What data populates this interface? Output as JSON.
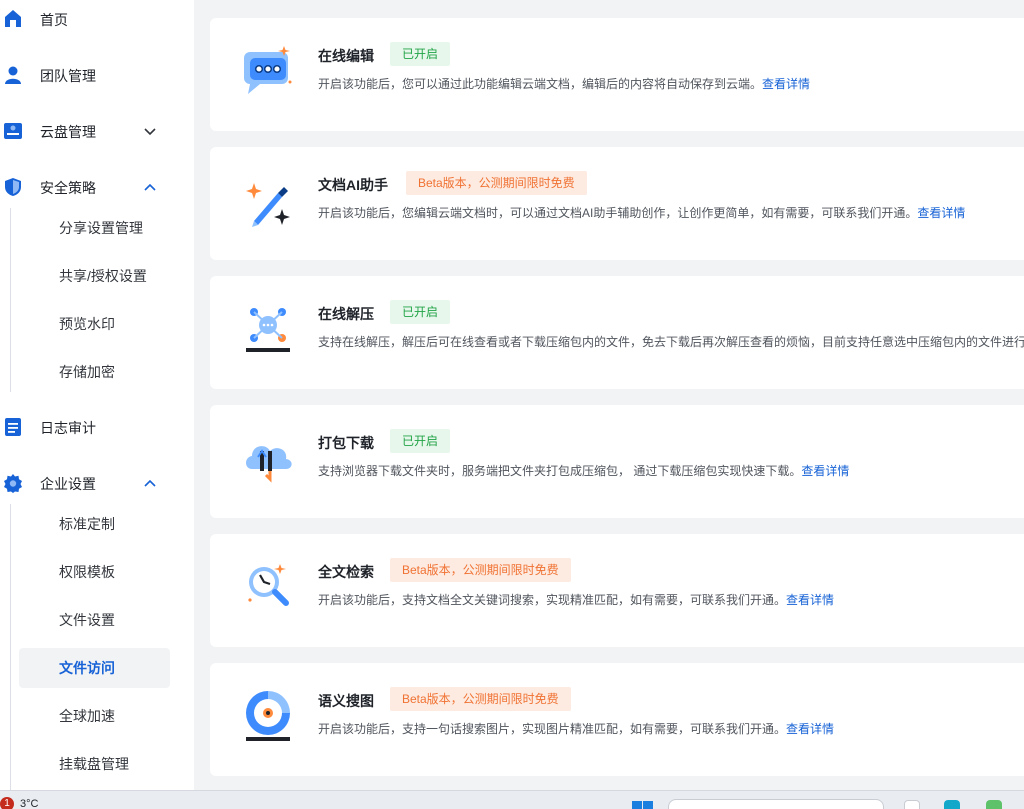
{
  "sidebar": {
    "items": [
      {
        "label": "首页",
        "icon": "home-icon"
      },
      {
        "label": "团队管理",
        "icon": "team-icon"
      },
      {
        "label": "云盘管理",
        "icon": "cloud-drive-icon",
        "chevron": "down"
      },
      {
        "label": "安全策略",
        "icon": "shield-icon",
        "chevron": "up"
      },
      {
        "label": "日志审计",
        "icon": "log-icon"
      },
      {
        "label": "企业设置",
        "icon": "gear-icon",
        "chevron": "up"
      }
    ],
    "security_sub": [
      "分享设置管理",
      "共享/授权设置",
      "预览水印",
      "存储加密"
    ],
    "enterprise_sub": [
      "标准定制",
      "权限模板",
      "文件设置",
      "文件访问",
      "全球加速",
      "挂载盘管理"
    ],
    "active": "文件访问"
  },
  "cards": [
    {
      "title": "在线编辑",
      "badge": "已开启",
      "badge_type": "on",
      "desc": "开启该功能后，您可以通过此功能编辑云端文档，编辑后的内容将自动保存到云端。",
      "link": "查看详情",
      "icon": "online-edit-icon"
    },
    {
      "title": "文档AI助手",
      "badge": "Beta版本，公测期间限时免费",
      "badge_type": "beta",
      "desc": "开启该功能后，您编辑云端文档时，可以通过文档AI助手辅助创作，让创作更简单，如有需要，可联系我们开通。",
      "link": "查看详情",
      "icon": "ai-assistant-icon"
    },
    {
      "title": "在线解压",
      "badge": "已开启",
      "badge_type": "on",
      "desc": "支持在线解压，解压后可在线查看或者下载压缩包内的文件，免去下载后再次解压查看的烦恼，目前支持任意选中压缩包内的文件进行",
      "link": "",
      "icon": "unzip-icon"
    },
    {
      "title": "打包下载",
      "badge": "已开启",
      "badge_type": "on",
      "desc": "支持浏览器下载文件夹时，服务端把文件夹打包成压缩包， 通过下载压缩包实现快速下载。",
      "link": "查看详情",
      "icon": "package-download-icon"
    },
    {
      "title": "全文检索",
      "badge": "Beta版本，公测期间限时免费",
      "badge_type": "beta",
      "desc": "开启该功能后，支持文档全文关键词搜索，实现精准匹配，如有需要，可联系我们开通。",
      "link": "查看详情",
      "icon": "fulltext-search-icon"
    },
    {
      "title": "语义搜图",
      "badge": "Beta版本，公测期间限时免费",
      "badge_type": "beta",
      "desc": "开启该功能后，支持一句话搜索图片，实现图片精准匹配，如有需要，可联系我们开通。",
      "link": "查看详情",
      "icon": "semantic-image-search-icon"
    }
  ],
  "taskbar": {
    "notification_count": "1",
    "weather": "3°C"
  }
}
